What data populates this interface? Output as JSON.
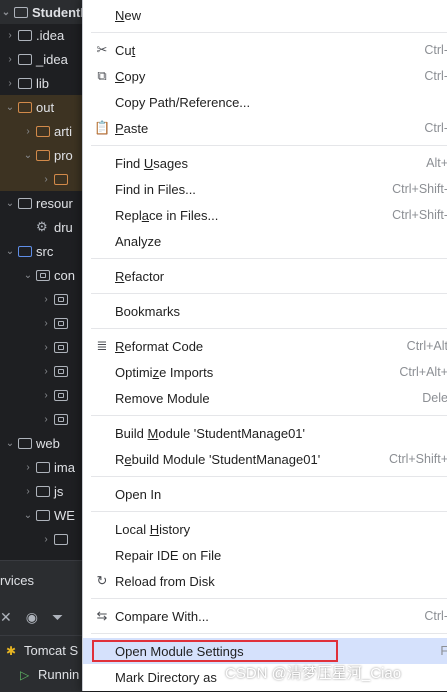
{
  "project": {
    "title": "StudentM",
    "items": [
      {
        "label": ".idea",
        "chev": "›",
        "icon": "folder",
        "depth": 0
      },
      {
        "label": "_idea",
        "chev": "›",
        "icon": "folder",
        "depth": 0
      },
      {
        "label": "lib",
        "chev": "›",
        "icon": "folder",
        "depth": 0
      },
      {
        "label": "out",
        "chev": "⌄",
        "icon": "folder-orange",
        "depth": 0
      },
      {
        "label": "arti",
        "chev": "›",
        "icon": "folder-orange",
        "depth": 1
      },
      {
        "label": "pro",
        "chev": "⌄",
        "icon": "folder-orange",
        "depth": 1
      },
      {
        "label": "",
        "chev": "›",
        "icon": "folder-orange",
        "depth": 2
      },
      {
        "label": "resour",
        "chev": "⌄",
        "icon": "folder",
        "depth": 0
      },
      {
        "label": "dru",
        "chev": "",
        "icon": "gear",
        "depth": 1
      },
      {
        "label": "src",
        "chev": "⌄",
        "icon": "folder-blue",
        "depth": 0
      },
      {
        "label": "con",
        "chev": "⌄",
        "icon": "package",
        "depth": 1
      },
      {
        "label": "",
        "chev": "›",
        "icon": "package",
        "depth": 2
      },
      {
        "label": "",
        "chev": "›",
        "icon": "package",
        "depth": 2
      },
      {
        "label": "",
        "chev": "›",
        "icon": "package",
        "depth": 2
      },
      {
        "label": "",
        "chev": "›",
        "icon": "package",
        "depth": 2
      },
      {
        "label": "",
        "chev": "›",
        "icon": "package",
        "depth": 2
      },
      {
        "label": "",
        "chev": "›",
        "icon": "package",
        "depth": 2
      },
      {
        "label": "web",
        "chev": "⌄",
        "icon": "folder",
        "depth": 0
      },
      {
        "label": "ima",
        "chev": "›",
        "icon": "folder",
        "depth": 1
      },
      {
        "label": "js",
        "chev": "›",
        "icon": "folder",
        "depth": 1
      },
      {
        "label": "WE",
        "chev": "⌄",
        "icon": "folder",
        "depth": 1
      },
      {
        "label": "",
        "chev": "›",
        "icon": "folder",
        "depth": 2
      }
    ]
  },
  "services": {
    "title": "rvices",
    "tomcat": "Tomcat S",
    "running": "Runnin"
  },
  "menu": {
    "items": [
      {
        "label": "New",
        "mn": "N",
        "shortcut": "",
        "icon": ""
      },
      {
        "sep": true
      },
      {
        "label": "Cut",
        "mn": "t",
        "shortcut": "Ctrl-",
        "icon": "✂"
      },
      {
        "label": "Copy",
        "mn": "C",
        "shortcut": "Ctrl-",
        "icon": "⧉"
      },
      {
        "label": "Copy Path/Reference...",
        "mn": "",
        "shortcut": "",
        "icon": ""
      },
      {
        "label": "Paste",
        "mn": "P",
        "shortcut": "Ctrl-",
        "icon": "📋"
      },
      {
        "sep": true
      },
      {
        "label": "Find Usages",
        "mn": "U",
        "shortcut": "Alt+",
        "icon": ""
      },
      {
        "label": "Find in Files...",
        "mn": "",
        "shortcut": "Ctrl+Shift-",
        "icon": ""
      },
      {
        "label": "Replace in Files...",
        "mn": "a",
        "shortcut": "Ctrl+Shift-",
        "icon": ""
      },
      {
        "label": "Analyze",
        "mn": "",
        "shortcut": "",
        "icon": ""
      },
      {
        "sep": true
      },
      {
        "label": "Refactor",
        "mn": "R",
        "shortcut": "",
        "icon": ""
      },
      {
        "sep": true
      },
      {
        "label": "Bookmarks",
        "mn": "",
        "shortcut": "",
        "icon": ""
      },
      {
        "sep": true
      },
      {
        "label": "Reformat Code",
        "mn": "R",
        "shortcut": "Ctrl+Alt",
        "icon": "≣"
      },
      {
        "label": "Optimize Imports",
        "mn": "z",
        "shortcut": "Ctrl+Alt+",
        "icon": ""
      },
      {
        "label": "Remove Module",
        "mn": "",
        "shortcut": "Dele",
        "icon": ""
      },
      {
        "sep": true
      },
      {
        "label": "Build Module 'StudentManage01'",
        "mn": "M",
        "shortcut": "",
        "icon": ""
      },
      {
        "label": "Rebuild Module 'StudentManage01'",
        "mn": "e",
        "shortcut": "Ctrl+Shift+",
        "icon": ""
      },
      {
        "sep": true
      },
      {
        "label": "Open In",
        "mn": "",
        "shortcut": "",
        "icon": ""
      },
      {
        "sep": true
      },
      {
        "label": "Local History",
        "mn": "H",
        "shortcut": "",
        "icon": ""
      },
      {
        "label": "Repair IDE on File",
        "mn": "",
        "shortcut": "",
        "icon": ""
      },
      {
        "label": "Reload from Disk",
        "mn": "",
        "shortcut": "",
        "icon": "↻"
      },
      {
        "sep": true
      },
      {
        "label": "Compare With...",
        "mn": "",
        "shortcut": "Ctrl-",
        "icon": "⇆"
      },
      {
        "sep": true
      },
      {
        "label": "Open Module Settings",
        "mn": "",
        "shortcut": "F",
        "icon": "",
        "selected": true
      },
      {
        "label": "Mark Directory as",
        "mn": "",
        "shortcut": "",
        "icon": ""
      }
    ]
  },
  "watermark": "CSDN @清梦压星河_Ciao",
  "colors": {
    "menu_bg": "#ffffff",
    "selection": "#d5e1fc",
    "highlight_box": "#e0303a",
    "ide_bg": "#1e1f22"
  }
}
